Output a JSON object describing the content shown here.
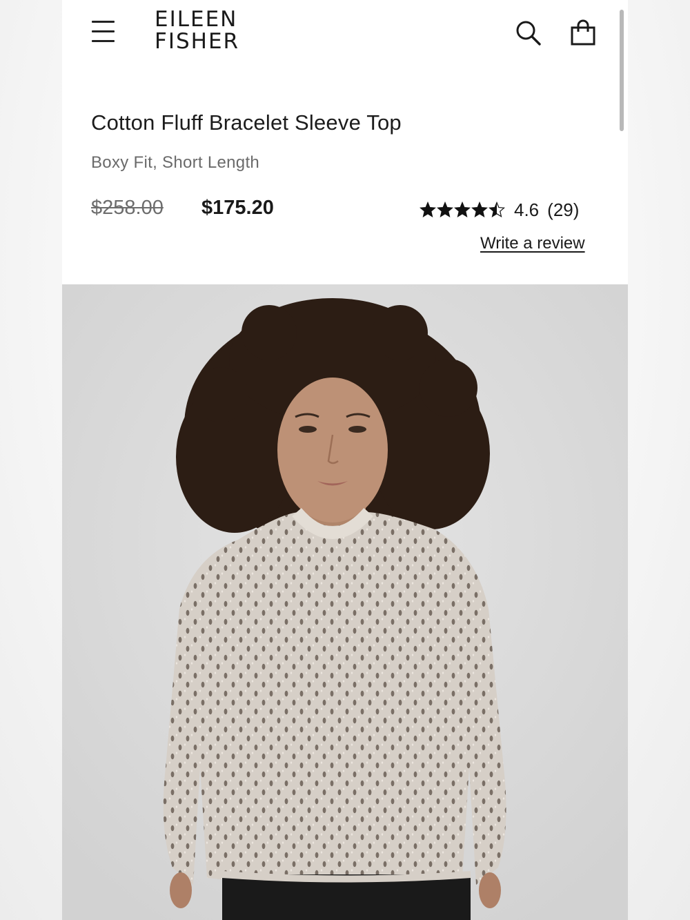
{
  "header": {
    "brand_line1": "EILEEN",
    "brand_line2": "FISHER",
    "menu_icon": "hamburger-menu-icon",
    "search_icon": "search-icon",
    "bag_icon": "shopping-bag-icon"
  },
  "product": {
    "title": "Cotton Fluff Bracelet Sleeve Top",
    "subtitle": "Boxy Fit, Short Length",
    "original_price": "$258.00",
    "sale_price": "$175.20",
    "rating": {
      "value": "4.6",
      "count": "(29)",
      "stars": 4.6,
      "max_stars": 5
    },
    "write_review_label": "Write a review"
  },
  "image": {
    "subject": "model wearing a light beige open-knit top",
    "background_color": "#dedede"
  }
}
